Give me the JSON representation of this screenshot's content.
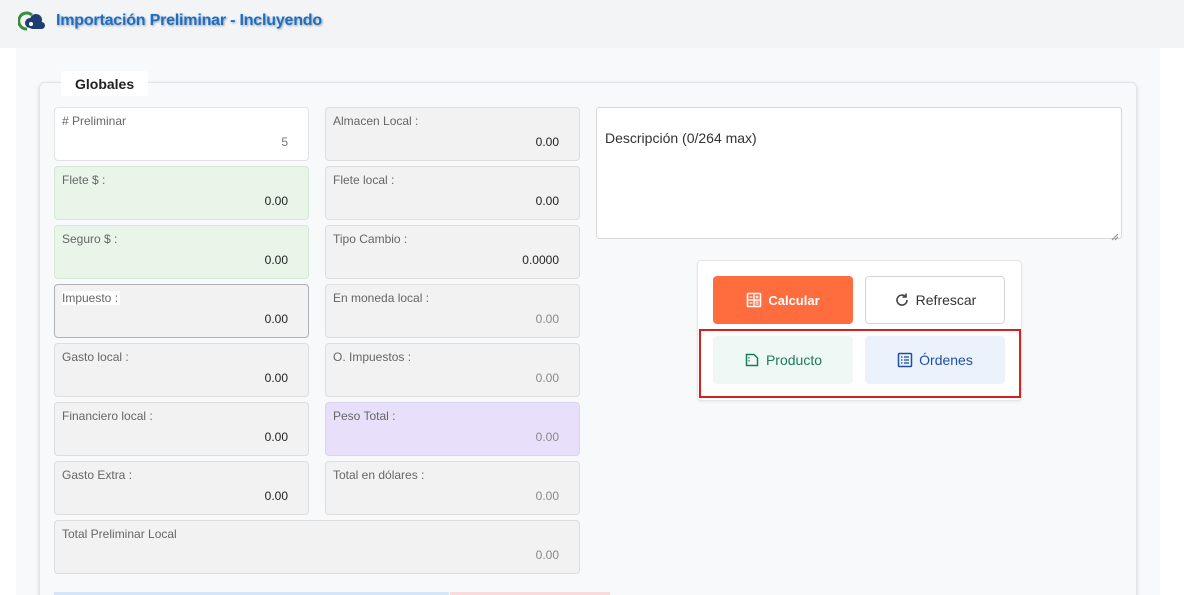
{
  "header": {
    "title": "Importación Preliminar - Incluyendo",
    "logo_icon": "cloud-logo-icon"
  },
  "section": {
    "title": "Globales"
  },
  "fields": {
    "preliminar": {
      "label": "# Preliminar",
      "value": "5"
    },
    "flete_usd": {
      "label": "Flete $ :",
      "value": "0.00"
    },
    "seguro_usd": {
      "label": "Seguro $ :",
      "value": "0.00"
    },
    "impuesto": {
      "label": "Impuesto :",
      "value": "0.00"
    },
    "gasto_local": {
      "label": "Gasto local :",
      "value": "0.00"
    },
    "financiero_local": {
      "label": "Financiero local :",
      "value": "0.00"
    },
    "gasto_extra": {
      "label": "Gasto Extra :",
      "value": "0.00"
    },
    "total_preliminar_local": {
      "label": "Total Preliminar Local",
      "value": "0.00"
    },
    "almacen_local": {
      "label": "Almacen Local :",
      "value": "0.00"
    },
    "flete_local": {
      "label": "Flete local :",
      "value": "0.00"
    },
    "tipo_cambio": {
      "label": "Tipo Cambio :",
      "value": "0.0000"
    },
    "en_moneda_local": {
      "label": "En moneda local :",
      "value": "0.00"
    },
    "o_impuestos": {
      "label": "O. Impuestos :",
      "value": "0.00"
    },
    "peso_total": {
      "label": "Peso Total :",
      "value": "0.00"
    },
    "total_dolares": {
      "label": "Total en dólares :",
      "value": "0.00"
    }
  },
  "description": {
    "placeholder": "Descripción (0/264 max)"
  },
  "buttons": {
    "calcular": "Calcular",
    "refrescar": "Refrescar",
    "producto": "Producto",
    "ordenes": "Órdenes"
  },
  "colors": {
    "title": "#1a6fc7",
    "calcular_bg": "#ff6c3e",
    "producto_text": "#1e7a5e",
    "ordenes_text": "#1d4fa6",
    "highlight": "#d32020",
    "green_field": "#e8f5e8",
    "purple_field": "#e8e0fa"
  }
}
